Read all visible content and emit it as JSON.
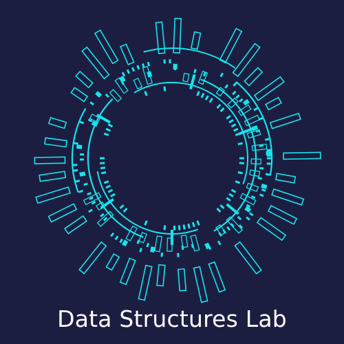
{
  "brand": {
    "name": "Data Structures Lab",
    "logo_description": "circular-data-ring-emblem"
  },
  "colors": {
    "background": "#1c1e41",
    "accent": "#19e3ec",
    "text": "#ffffff"
  }
}
